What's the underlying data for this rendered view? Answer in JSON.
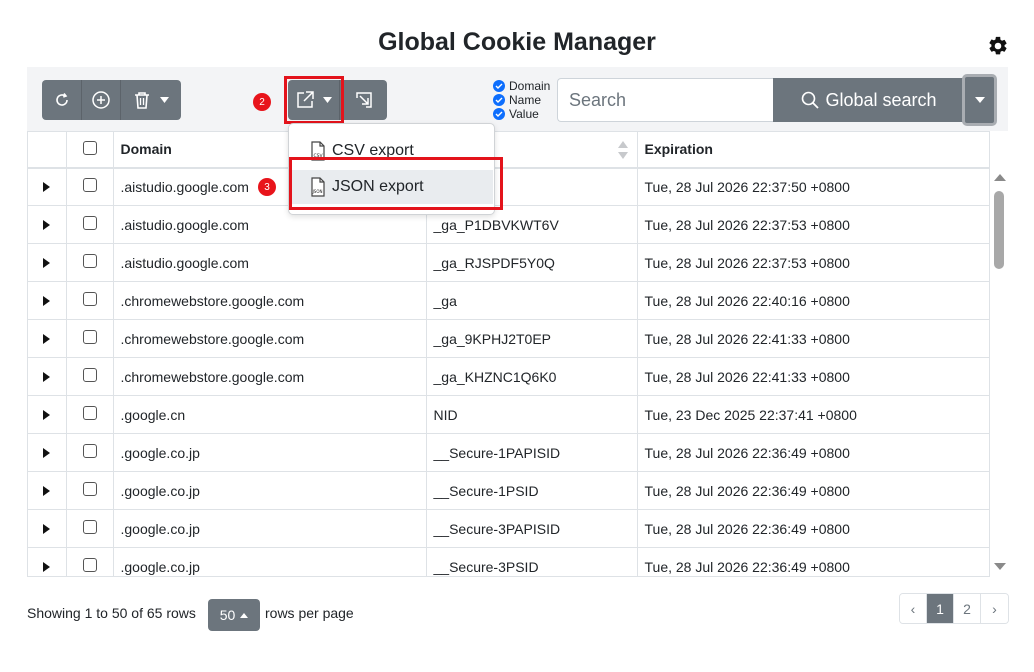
{
  "app": {
    "title": "Global Cookie Manager"
  },
  "annotations": {
    "step2": "2",
    "step3": "3"
  },
  "search": {
    "filters": [
      {
        "label": "Domain",
        "checked": true
      },
      {
        "label": "Name",
        "checked": true
      },
      {
        "label": "Value",
        "checked": true
      }
    ],
    "placeholder": "Search",
    "button_label": "Global search"
  },
  "export_menu": {
    "items": [
      {
        "label": "CSV export",
        "icon": "csv-file-icon"
      },
      {
        "label": "JSON export",
        "icon": "json-file-icon"
      }
    ]
  },
  "table": {
    "headers": {
      "domain": "Domain",
      "expiration": "Expiration"
    },
    "rows": [
      {
        "domain": ".aistudio.google.com",
        "name": "",
        "expiration": "Tue, 28 Jul 2026 22:37:50 +0800"
      },
      {
        "domain": ".aistudio.google.com",
        "name": "_ga_P1DBVKWT6V",
        "expiration": "Tue, 28 Jul 2026 22:37:53 +0800"
      },
      {
        "domain": ".aistudio.google.com",
        "name": "_ga_RJSPDF5Y0Q",
        "expiration": "Tue, 28 Jul 2026 22:37:53 +0800"
      },
      {
        "domain": ".chromewebstore.google.com",
        "name": "_ga",
        "expiration": "Tue, 28 Jul 2026 22:40:16 +0800"
      },
      {
        "domain": ".chromewebstore.google.com",
        "name": "_ga_9KPHJ2T0EP",
        "expiration": "Tue, 28 Jul 2026 22:41:33 +0800"
      },
      {
        "domain": ".chromewebstore.google.com",
        "name": "_ga_KHZNC1Q6K0",
        "expiration": "Tue, 28 Jul 2026 22:41:33 +0800"
      },
      {
        "domain": ".google.cn",
        "name": "NID",
        "expiration": "Tue, 23 Dec 2025 22:37:41 +0800"
      },
      {
        "domain": ".google.co.jp",
        "name": "__Secure-1PAPISID",
        "expiration": "Tue, 28 Jul 2026 22:36:49 +0800"
      },
      {
        "domain": ".google.co.jp",
        "name": "__Secure-1PSID",
        "expiration": "Tue, 28 Jul 2026 22:36:49 +0800"
      },
      {
        "domain": ".google.co.jp",
        "name": "__Secure-3PAPISID",
        "expiration": "Tue, 28 Jul 2026 22:36:49 +0800"
      },
      {
        "domain": ".google.co.jp",
        "name": "__Secure-3PSID",
        "expiration": "Tue, 28 Jul 2026 22:36:49 +0800"
      }
    ]
  },
  "footer": {
    "showing": "Showing 1 to 50 of 65 rows",
    "page_size": "50",
    "per_page_label": "rows per page",
    "pages": [
      "‹",
      "1",
      "2",
      "›"
    ],
    "active_page": "1"
  },
  "colors": {
    "button": "#6c757d",
    "highlight": "#e3131b",
    "checkbox": "#0d6efd"
  }
}
